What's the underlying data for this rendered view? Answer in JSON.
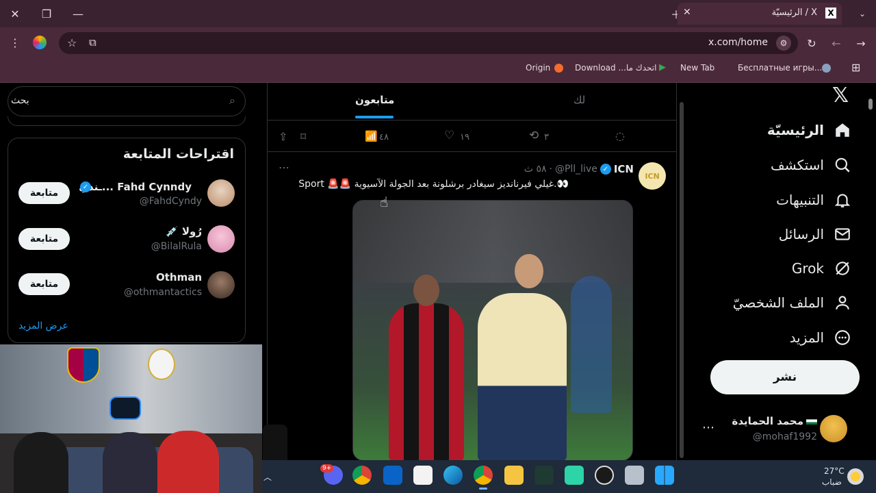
{
  "browser": {
    "tab_title": "الرئيسيّة / X",
    "url": "x.com/home",
    "bookmarks": [
      "Origin",
      "Download ...اتحدك ما",
      "New Tab",
      "Бесплатные игры..."
    ]
  },
  "nav": {
    "items": [
      "الرئيسيّة",
      "استكشف",
      "التنبيهات",
      "الرسائل",
      "Grok",
      "الملف الشخصيّ",
      "المزيد"
    ],
    "post_label": "نشر",
    "user_name": "محمد الحمايدة",
    "user_handle": "@mohaf1992"
  },
  "timeline": {
    "tabs": [
      "لك",
      "متابعون"
    ],
    "prev_actions": {
      "replies": "",
      "reposts": "٣",
      "likes": "١٩",
      "views": "٤٨"
    },
    "post": {
      "author": "ICN",
      "handle": "@Pll_live",
      "time": "٥٨ ث",
      "text": "👀.غيلي فيرنانديز سيغادر برشلونة بعد الجولة الآسيوية 🚨🚨 Sport"
    }
  },
  "sidebar": {
    "search_placeholder": "بحث",
    "suggestions_title": "اقتراحات المتابعة",
    "follow_label": "متابعة",
    "suggestions": [
      {
        "name": "Fahd Cynndy ...ـندي",
        "handle": "@FahdCyndy"
      },
      {
        "name": "رُولا 💉",
        "handle": "@BilalRula"
      },
      {
        "name": "Othman",
        "handle": "@othmantactics"
      }
    ],
    "show_more": "عرض المزيد"
  },
  "taskbar": {
    "temp": "27°C",
    "weather": "ضباب",
    "badge": "9+"
  },
  "colors": {
    "chrome": "#4a2a3a",
    "accent": "#1d9bf0",
    "verified": "#1d9bf0"
  }
}
